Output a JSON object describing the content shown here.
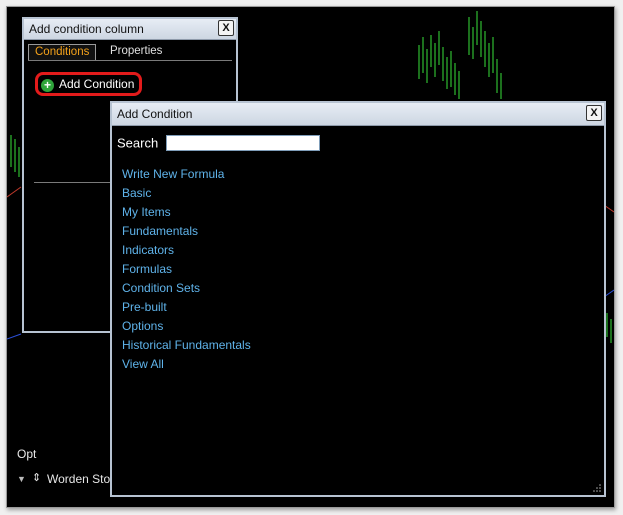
{
  "cond_column": {
    "title": "Add condition column",
    "close_label": "X",
    "tabs": [
      {
        "label": "Conditions",
        "active": true
      },
      {
        "label": "Properties",
        "active": false
      }
    ],
    "add_condition_label": "Add Condition"
  },
  "add_condition": {
    "title": "Add Condition",
    "close_label": "X",
    "search_label": "Search",
    "search_value": "",
    "items": [
      {
        "label": "Write New Formula"
      },
      {
        "label": "Basic"
      },
      {
        "label": "My Items"
      },
      {
        "label": "Fundamentals"
      },
      {
        "label": "Indicators"
      },
      {
        "label": "Formulas"
      },
      {
        "label": "Condition Sets"
      },
      {
        "label": "Pre-built"
      },
      {
        "label": "Options"
      },
      {
        "label": "Historical Fundamentals"
      },
      {
        "label": "View All"
      }
    ]
  },
  "background": {
    "opt_label": "Opt",
    "bottom_label": "Worden Sto"
  },
  "colors": {
    "link": "#5fb3ea",
    "accent_tab": "#f4a21b",
    "highlight_ring": "#e31b1b",
    "plus": "#2ea43a",
    "chart_bars": "#37e03a"
  },
  "icons": [
    "close-icon",
    "plus-circle-icon",
    "resize-grip-icon",
    "dropdown-arrow-icon",
    "sort-arrows-icon"
  ]
}
